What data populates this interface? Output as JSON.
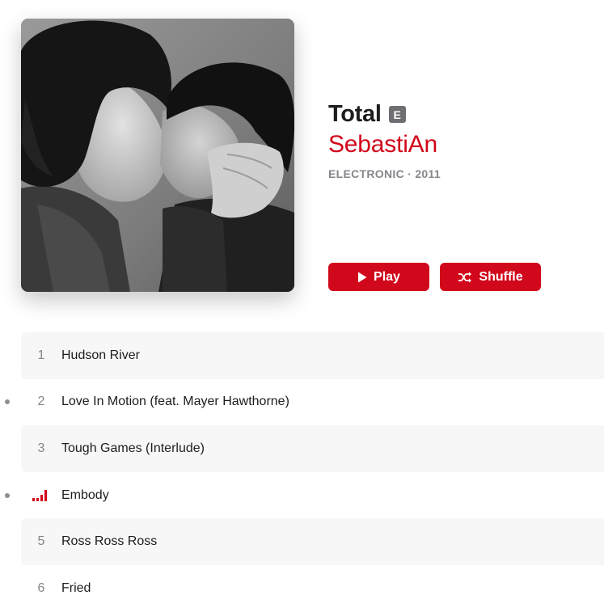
{
  "album": {
    "title": "Total",
    "explicit_badge": "E",
    "artist": "SebastiAn",
    "genre_year": "ELECTRONIC · 2011",
    "artwork_icon": "album-artwork-photo"
  },
  "actions": {
    "play_label": "Play",
    "shuffle_label": "Shuffle",
    "accent_color": "#d1071b"
  },
  "tracks": [
    {
      "number": "1",
      "title": "Hudson River"
    },
    {
      "number": "2",
      "title": "Love In Motion (feat. Mayer Hawthorne)"
    },
    {
      "number": "3",
      "title": "Tough Games (Interlude)"
    },
    {
      "number": "",
      "title": "Embody",
      "now_playing": true
    },
    {
      "number": "5",
      "title": "Ross Ross Ross"
    },
    {
      "number": "6",
      "title": "Fried"
    }
  ]
}
